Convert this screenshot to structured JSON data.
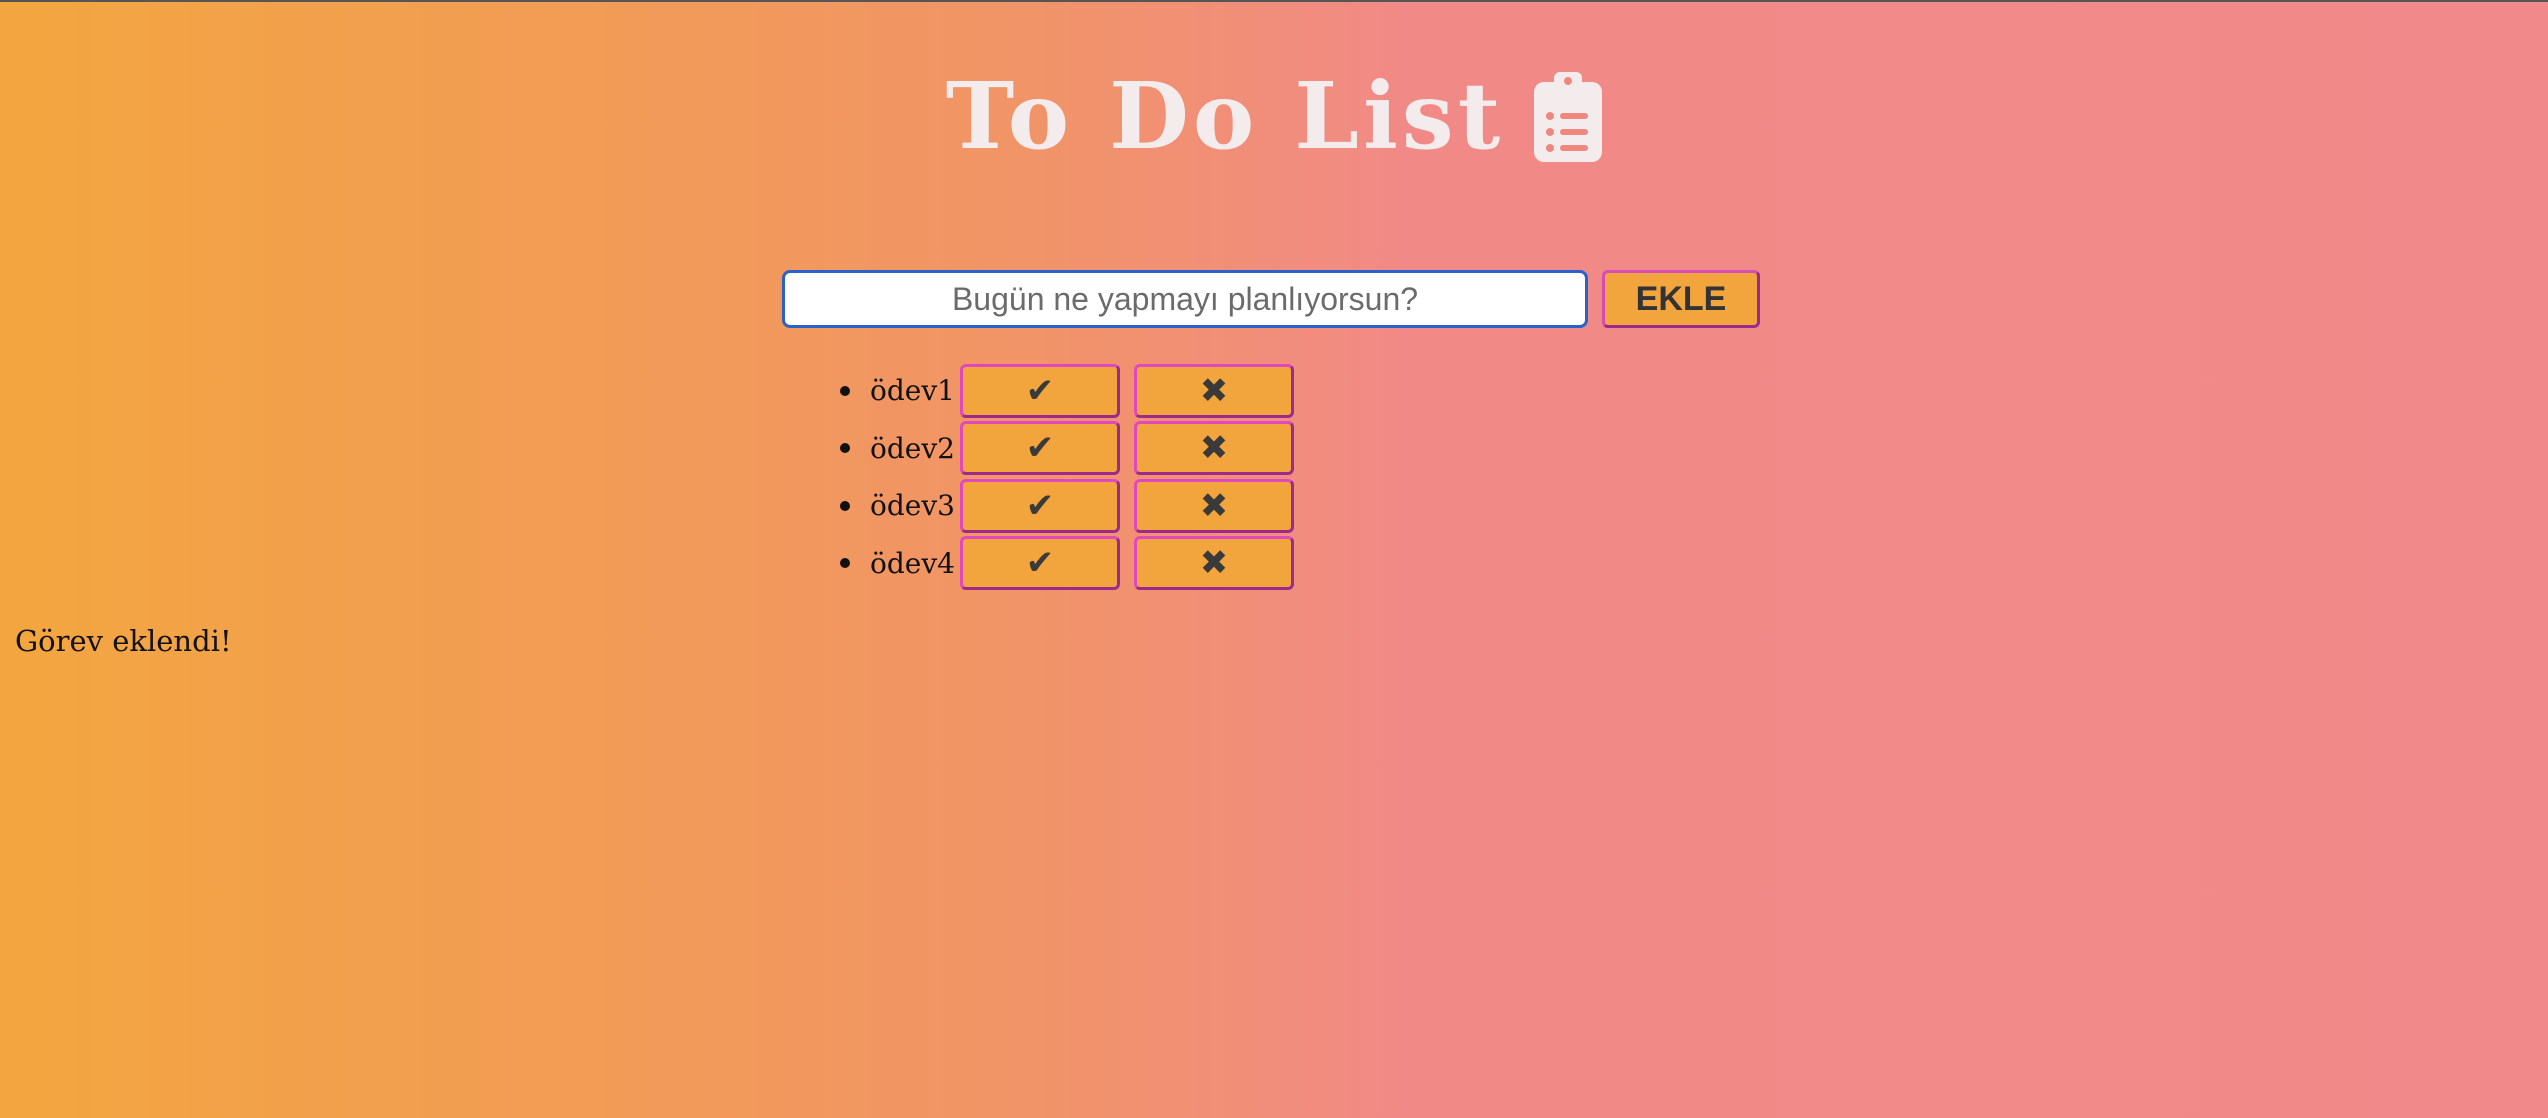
{
  "header": {
    "title": "To Do List",
    "icon": "clipboard-list-icon"
  },
  "input": {
    "value": "",
    "placeholder": "Bugün ne yapmayı planlıyorsun?"
  },
  "add_button": {
    "label": "EKLE"
  },
  "tasks": [
    {
      "label": "ödev1",
      "complete_icon": "✔",
      "delete_icon": "✖"
    },
    {
      "label": "ödev2",
      "complete_icon": "✔",
      "delete_icon": "✖"
    },
    {
      "label": "ödev3",
      "complete_icon": "✔",
      "delete_icon": "✖"
    },
    {
      "label": "ödev4",
      "complete_icon": "✔",
      "delete_icon": "✖"
    }
  ],
  "status": {
    "message": "Görev eklendi!"
  },
  "colors": {
    "background_start": "#f3a63f",
    "background_end": "#f1898a",
    "button_fill": "#f2a53d",
    "button_border": "#e048c0",
    "title_text": "#f4ecec",
    "input_border": "#2a62c9"
  }
}
